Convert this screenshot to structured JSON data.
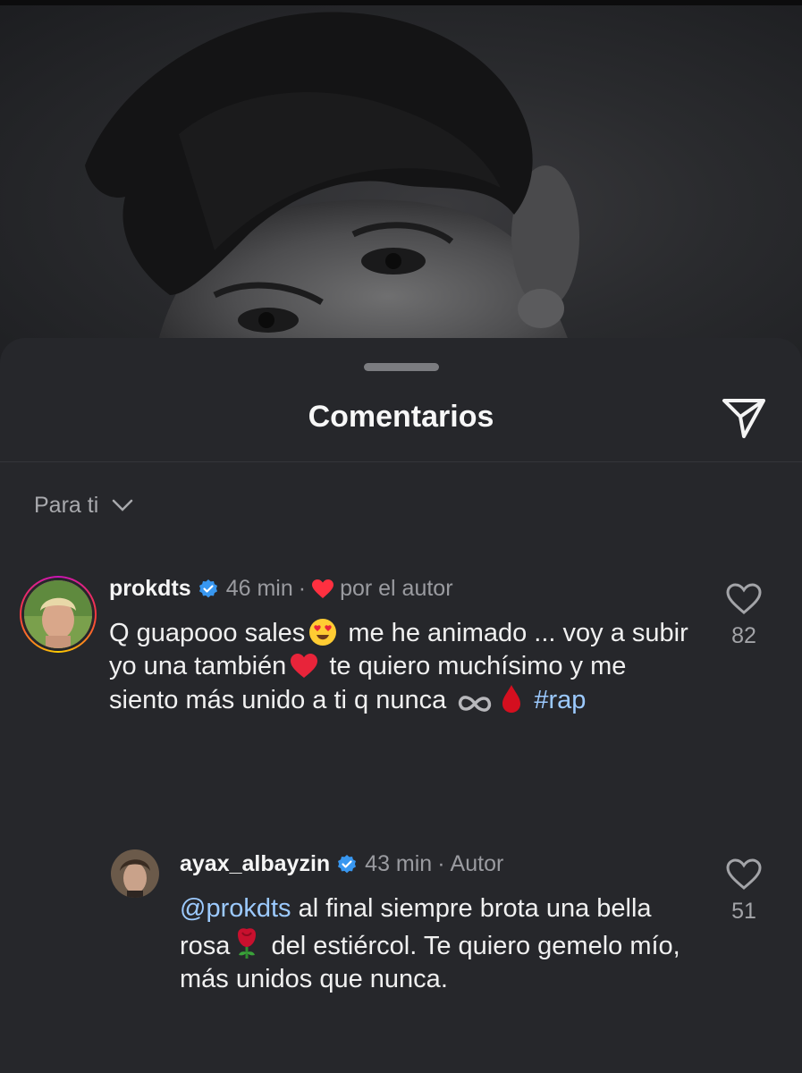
{
  "sheet": {
    "title": "Comentarios",
    "sort_label": "Para ti"
  },
  "colors": {
    "background": "#26272b",
    "accent_link": "#9ccaff",
    "verified": "#3897f0",
    "heart": "#ff3040"
  },
  "comments": [
    {
      "username": "prokdts",
      "verified": true,
      "time": "46 min",
      "separator": "·",
      "badge": "por el autor",
      "text_parts": [
        "Q guapooo sales",
        "me he animado ... voy a subir yo una también",
        "te quiero muchísimo y me siento más unido a ti q nunca",
        "#rap"
      ],
      "likes": "82"
    },
    {
      "username": "ayax_albayzin",
      "verified": true,
      "time": "43 min",
      "separator": "·",
      "badge": "Autor",
      "mention": "@prokdts",
      "text_parts": [
        "al final siempre brota una bella rosa",
        "del estiércol. Te quiero gemelo mío, más unidos que nunca."
      ],
      "likes": "51"
    }
  ],
  "icons": [
    "send-icon",
    "chevron-down-icon",
    "verified-badge-icon",
    "heart-icon",
    "heart-outline-icon"
  ]
}
